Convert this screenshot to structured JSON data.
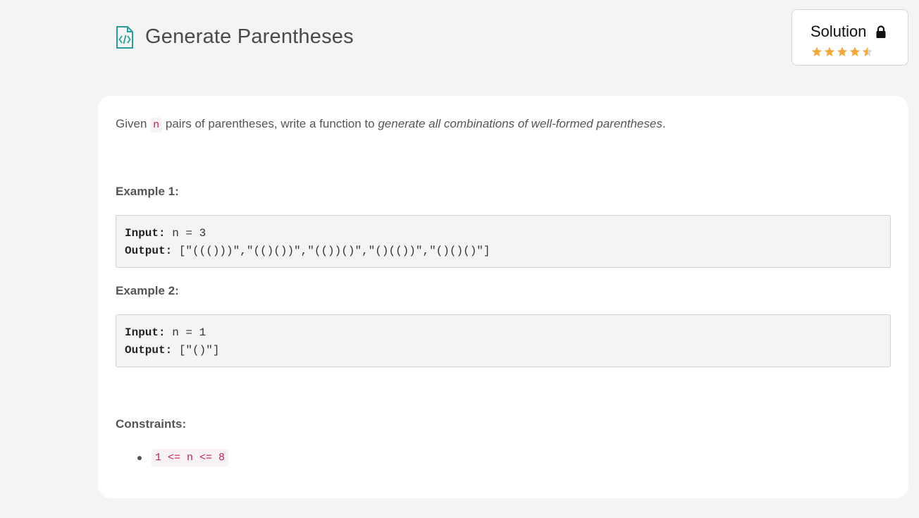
{
  "problem": {
    "title": "Generate Parentheses",
    "icon": "code-file-icon",
    "accent_color": "#2a9d9d"
  },
  "solution": {
    "label": "Solution",
    "locked_icon": "lock-icon",
    "rating": 4.5,
    "star_color": "#f0a83c"
  },
  "description": {
    "prefix": "Given ",
    "var": "n",
    "middle": " pairs of parentheses, write a function to ",
    "emphasis": "generate all combinations of well-formed parentheses",
    "suffix": "."
  },
  "examples": [
    {
      "heading": "Example 1:",
      "input_label": "Input:",
      "input_value": " n = 3",
      "output_label": "Output:",
      "output_value": " [\"((()))\",\"(()())\",\"(())()\",\"()(())\",\"()()()\"]"
    },
    {
      "heading": "Example 2:",
      "input_label": "Input:",
      "input_value": " n = 1",
      "output_label": "Output:",
      "output_value": " [\"()\"]"
    }
  ],
  "constraints": {
    "heading": "Constraints:",
    "items": [
      "1 <= n <= 8"
    ]
  }
}
